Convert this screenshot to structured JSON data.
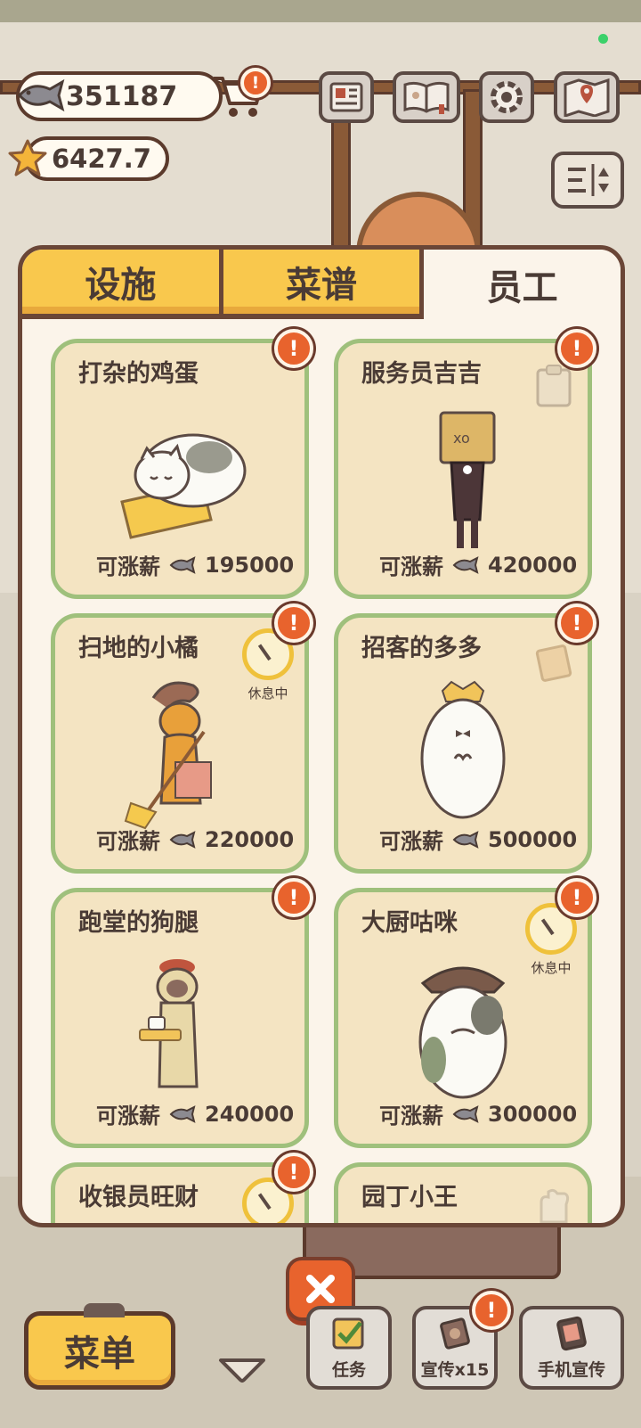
{
  "currency": {
    "fish": "351187",
    "stars": "6427.7"
  },
  "top_icons": [
    "cart-icon",
    "newspaper-icon",
    "recipe-book-icon",
    "gear-icon",
    "map-icon",
    "sort-icon"
  ],
  "tabs": [
    {
      "label": "设施",
      "active": false
    },
    {
      "label": "菜谱",
      "active": false
    },
    {
      "label": "员工",
      "active": true
    }
  ],
  "staff": [
    {
      "name": "打杂的鸡蛋",
      "salary_label": "可涨薪",
      "salary": "195000",
      "resting": false
    },
    {
      "name": "服务员吉吉",
      "salary_label": "可涨薪",
      "salary": "420000",
      "resting": false
    },
    {
      "name": "扫地的小橘",
      "salary_label": "可涨薪",
      "salary": "220000",
      "resting": true,
      "rest_label": "休息中"
    },
    {
      "name": "招客的多多",
      "salary_label": "可涨薪",
      "salary": "500000",
      "resting": false
    },
    {
      "name": "跑堂的狗腿",
      "salary_label": "可涨薪",
      "salary": "240000",
      "resting": false
    },
    {
      "name": "大厨咕咪",
      "salary_label": "可涨薪",
      "salary": "300000",
      "resting": true,
      "rest_label": "休息中"
    },
    {
      "name": "收银员旺财",
      "resting": true
    },
    {
      "name": "园丁小王",
      "resting": false
    }
  ],
  "bottom": {
    "menu_label": "菜单",
    "tasks_label": "任务",
    "promo_label": "宣传x15",
    "phone_promo_label": "手机宣传"
  },
  "colors": {
    "tab_yellow": "#f9c84d",
    "card_border": "#9fc07c",
    "badge_orange": "#e8632d",
    "panel_bg": "#fbf4ea"
  }
}
